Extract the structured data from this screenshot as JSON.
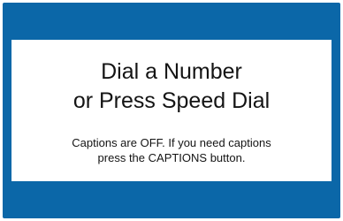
{
  "screen": {
    "message_line_1": "Dial a Number",
    "message_line_2": "or Press Speed Dial",
    "captions_line_1": "Captions are OFF. If you need captions",
    "captions_line_2": "press the CAPTIONS button."
  },
  "colors": {
    "frame": "#0b67a8",
    "panel": "#ffffff",
    "text": "#141414"
  }
}
